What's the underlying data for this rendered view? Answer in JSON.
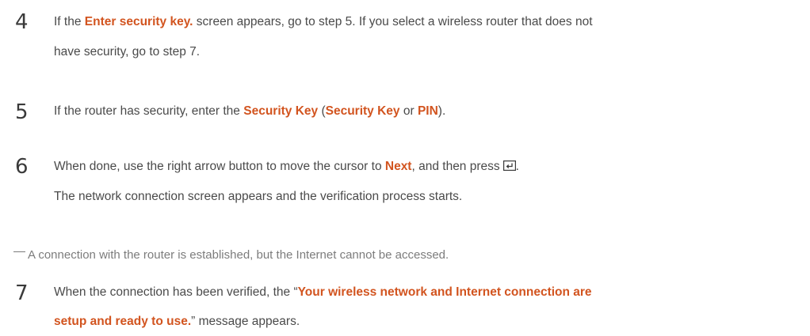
{
  "steps": [
    {
      "number": "4",
      "line1_a": "If the ",
      "line1_b": "Enter security key.",
      "line1_c": " screen appears, go to step 5. If you select a wireless router that does not",
      "line2": "have security, go to step 7."
    },
    {
      "number": "5",
      "a": "If the router has security, enter the ",
      "b": "Security Key",
      "c": " (",
      "d": "Security Key",
      "e": " or ",
      "f": "PIN",
      "g": ")."
    },
    {
      "number": "6",
      "line1_a": "When done, use the right arrow button to move the cursor to ",
      "line1_b": "Next",
      "line1_c": ", and then press",
      "line1_d": ".",
      "line2": "The network connection screen appears and the verification process starts."
    },
    {
      "number": "7",
      "line1_a": "When the connection has been verified, the “",
      "line1_b": "Your wireless network and Internet connection are",
      "line2_a": "setup and ready to use.",
      "line2_b": "” message appears."
    }
  ],
  "note": {
    "text": "A connection with the router is established, but the Internet cannot be accessed."
  },
  "icons": {
    "enter": "enter-key-icon"
  },
  "colors": {
    "highlight": "#d2541f",
    "body_text": "#4a4a4a",
    "note_text": "#7c7c7c"
  }
}
